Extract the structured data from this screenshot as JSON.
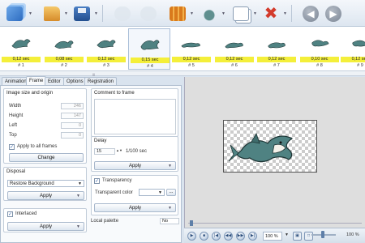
{
  "toolbar": {
    "buttons": [
      {
        "name": "add-frames-icon"
      },
      {
        "name": "open-folder-icon"
      },
      {
        "name": "save-disk-icon"
      },
      {
        "name": "disabled-icon-1"
      },
      {
        "name": "disabled-icon-2"
      },
      {
        "name": "film-strip-icon"
      },
      {
        "name": "shark-effect-icon"
      },
      {
        "name": "copy-icon"
      },
      {
        "name": "delete-icon"
      },
      {
        "name": "move-left-icon"
      },
      {
        "name": "move-right-icon"
      }
    ],
    "arrow_left": "◀",
    "arrow_right": "▶",
    "delete_glyph": "✖"
  },
  "frames": [
    {
      "delay": "0,12 sec",
      "number": "# 1"
    },
    {
      "delay": "0,08 sec",
      "number": "# 2"
    },
    {
      "delay": "0,12 sec",
      "number": "# 3"
    },
    {
      "delay": "0,15 sec",
      "number": "# 4"
    },
    {
      "delay": "0,12 sec",
      "number": "# 5"
    },
    {
      "delay": "0,12 sec",
      "number": "# 6"
    },
    {
      "delay": "0,12 sec",
      "number": "# 7"
    },
    {
      "delay": "0,10 sec",
      "number": "# 8"
    },
    {
      "delay": "0,12 sec",
      "number": "# 9"
    }
  ],
  "tabs": [
    "Animation",
    "Frame",
    "Editor",
    "Options",
    "Registration"
  ],
  "active_tab": "Frame",
  "image_size": {
    "title": "Image size and origin",
    "width_label": "Width",
    "width_value": "246",
    "height_label": "Height",
    "height_value": "147",
    "left_label": "Left",
    "left_value": "0",
    "top_label": "Top",
    "top_value": "0",
    "apply_all_label": "Apply to all frames",
    "change_label": "Change"
  },
  "disposal": {
    "title": "Disposal",
    "selected": "Restore Background",
    "apply_label": "Apply"
  },
  "interlaced": {
    "label": "Interlaced",
    "apply_label": "Apply"
  },
  "comment": {
    "title": "Comment to frame"
  },
  "delay": {
    "title": "Delay",
    "value": "15",
    "unit": "1/100 sec",
    "apply_label": "Apply"
  },
  "transparency": {
    "label": "Transparency",
    "color_label": "Transparent color",
    "apply_label": "Apply"
  },
  "local_palette": {
    "label": "Local palette",
    "value": "No"
  },
  "playback": {
    "zoom_left": "100 %",
    "zoom_right": "100 %"
  },
  "colors": {
    "frame_delay_bg": "#f4ef3a",
    "shark_body": "#4f8282",
    "selection_border": "#a9bed8"
  }
}
